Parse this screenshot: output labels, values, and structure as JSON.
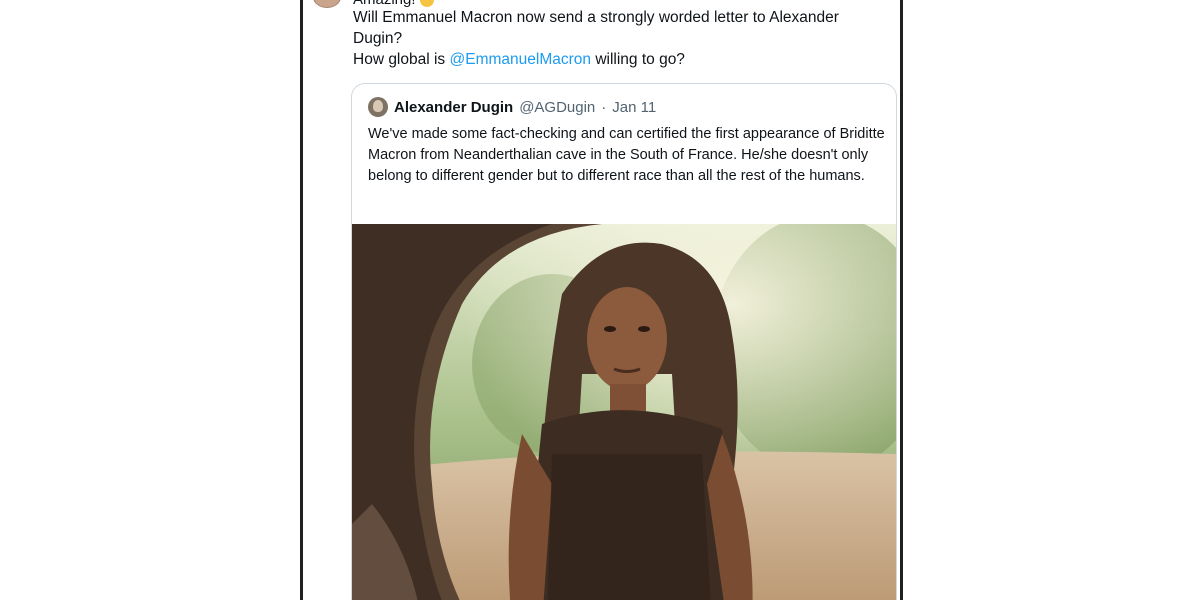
{
  "tweet": {
    "cut_line": "Amazing!",
    "line1": "Will Emmanuel Macron now send a strongly worded letter to Alexander Dugin?",
    "line2_before": "How global is ",
    "mention": "@EmmanuelMacron",
    "line2_after": " willing to go?"
  },
  "quoted": {
    "name": "Alexander Dugin",
    "handle": "@AGDugin",
    "separator": "·",
    "date": "Jan 11",
    "text": "We've made some fact-checking and can certified the first appearance of Briditte Macron from Neanderthalian cave in the South of France. He/she doesn't only belong to different gender but to different race than all the rest of the humans.",
    "media_icon": "photo-cave-figure"
  },
  "colors": {
    "link": "#1d9bf0",
    "text": "#0f1419",
    "secondary": "#536471",
    "border": "#cfd9de"
  }
}
